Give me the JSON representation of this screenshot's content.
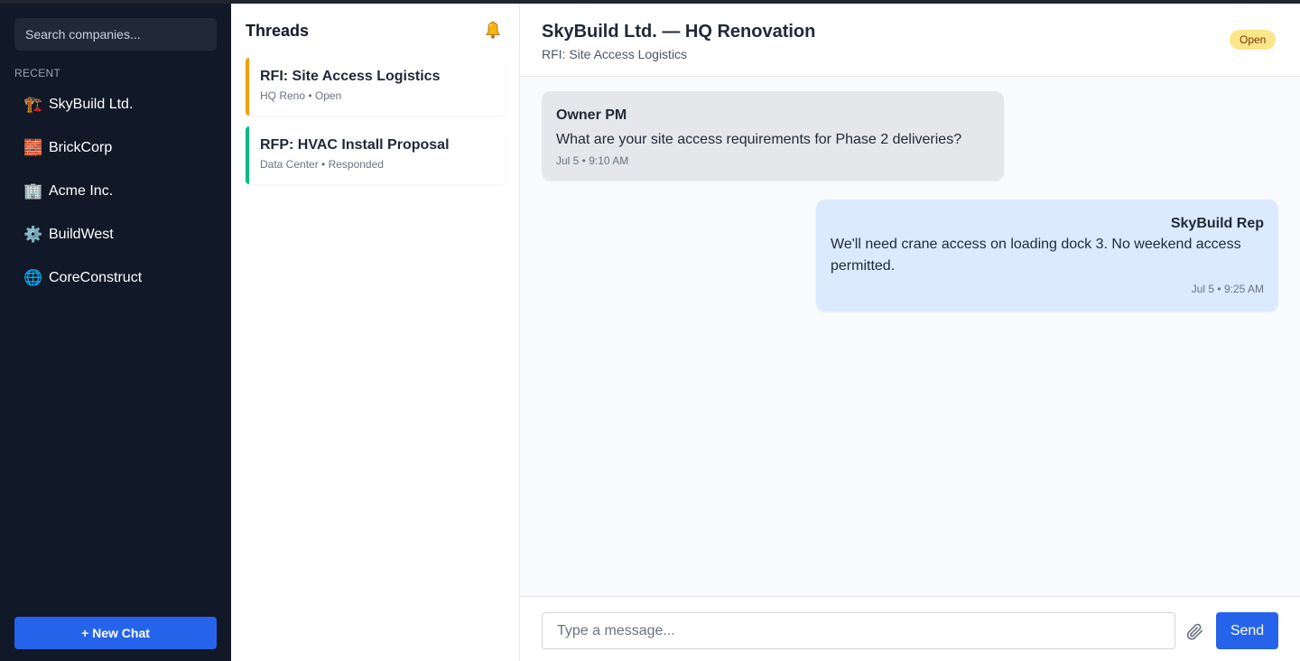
{
  "sidebar": {
    "search_placeholder": "Search companies...",
    "recent_label": "RECENT",
    "companies": [
      {
        "icon": "🏗️",
        "icon_name": "construction-crane-icon",
        "name": "SkyBuild Ltd."
      },
      {
        "icon": "🧱",
        "icon_name": "brick-icon",
        "name": "BrickCorp"
      },
      {
        "icon": "🏢",
        "icon_name": "office-building-icon",
        "name": "Acme Inc."
      },
      {
        "icon": "⚙️",
        "icon_name": "gear-icon",
        "name": "BuildWest"
      },
      {
        "icon": "🌐",
        "icon_name": "globe-icon",
        "name": "CoreConstruct"
      }
    ],
    "new_chat_label": "+ New Chat"
  },
  "threads": {
    "title": "Threads",
    "items": [
      {
        "title": "RFI: Site Access Logistics",
        "subtitle": "HQ Reno • Open",
        "accent": "#f59e0b"
      },
      {
        "title": "RFP: HVAC Install Proposal",
        "subtitle": "Data Center • Responded",
        "accent": "#10b981"
      }
    ]
  },
  "conversation": {
    "title": "SkyBuild Ltd. — HQ Renovation",
    "subtitle": "RFI: Site Access Logistics",
    "status": "Open",
    "messages": [
      {
        "author": "Owner PM",
        "text": "What are your site access requirements for Phase 2 deliveries?",
        "time": "Jul 5 • 9:10 AM",
        "direction": "incoming"
      },
      {
        "author": "SkyBuild Rep",
        "text": "We'll need crane access on loading dock 3. No weekend access permitted.",
        "time": "Jul 5 • 9:25 AM",
        "direction": "outgoing"
      }
    ]
  },
  "composer": {
    "placeholder": "Type a message...",
    "send_label": "Send"
  },
  "colors": {
    "accent": "#2563eb",
    "sidebar_bg": "#111827",
    "open_badge": "#fde68a"
  }
}
